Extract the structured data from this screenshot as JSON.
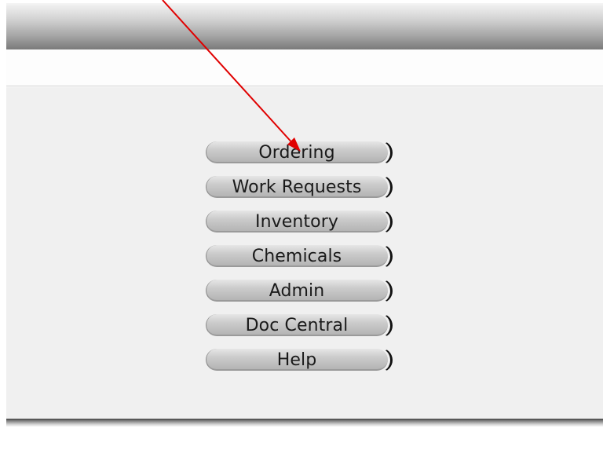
{
  "menu": {
    "items": [
      {
        "label": "Ordering"
      },
      {
        "label": "Work Requests"
      },
      {
        "label": "Inventory"
      },
      {
        "label": "Chemicals"
      },
      {
        "label": "Admin"
      },
      {
        "label": "Doc Central"
      },
      {
        "label": "Help"
      }
    ]
  },
  "annotation": {
    "arrow_icon": "red-arrow-icon",
    "arrow_color": "#e00000"
  },
  "colors": {
    "panel_background": "#f0f0f0",
    "button_face": "#c8c8c8",
    "button_text": "#1a1a1a"
  }
}
